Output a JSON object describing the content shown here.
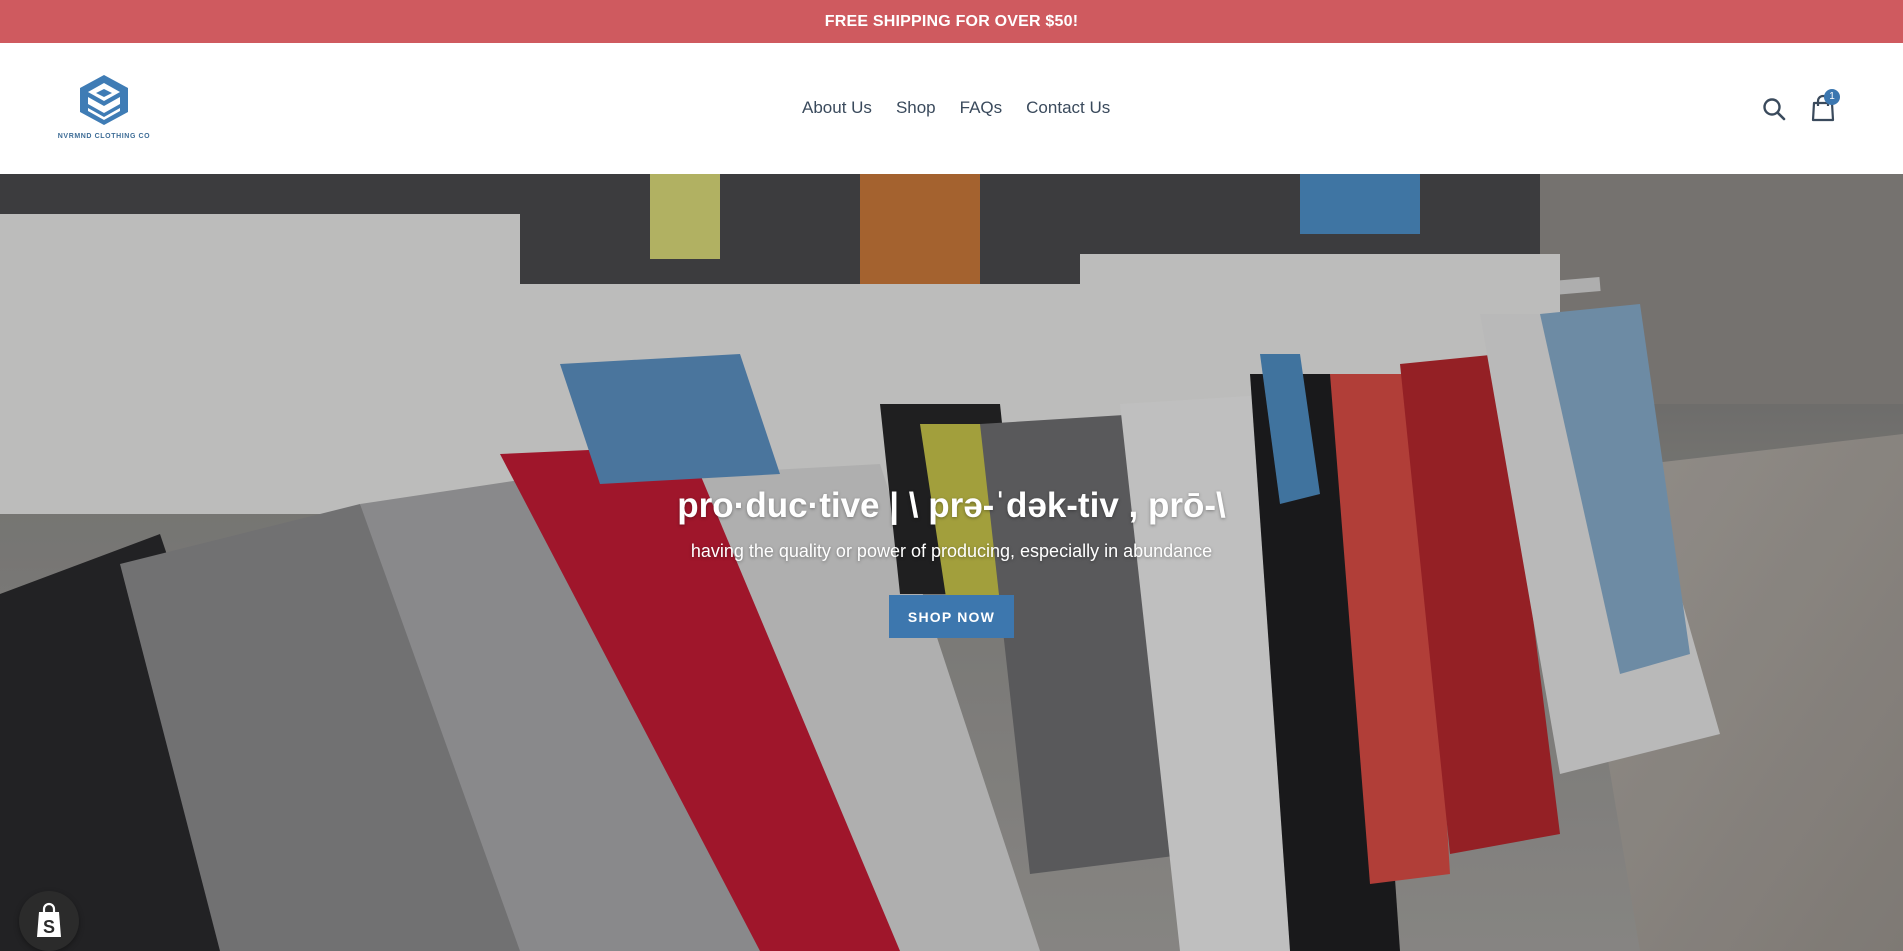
{
  "announcement": {
    "text": "FREE SHIPPING FOR OVER $50!"
  },
  "header": {
    "logo_text": "NVRMND CLOTHING CO",
    "nav": [
      {
        "label": "About Us"
      },
      {
        "label": "Shop"
      },
      {
        "label": "FAQs"
      },
      {
        "label": "Contact Us"
      }
    ],
    "search_icon": "search-icon",
    "cart_icon": "shopping-bag-icon",
    "cart_count": "1"
  },
  "hero": {
    "title": "pro·duc·tive | \\ prə-ˈdək-tiv , prō-\\",
    "subtitle": "having the quality or power of producing, especially in abundance",
    "button_label": "SHOP NOW",
    "background": "clothing-rack-photo"
  },
  "shopify_badge": {
    "icon": "shopify-bag-icon"
  },
  "colors": {
    "announcement_bg": "#cf5a5f",
    "accent": "#3d77ae",
    "nav_text": "#3a4a5c",
    "white": "#ffffff"
  }
}
